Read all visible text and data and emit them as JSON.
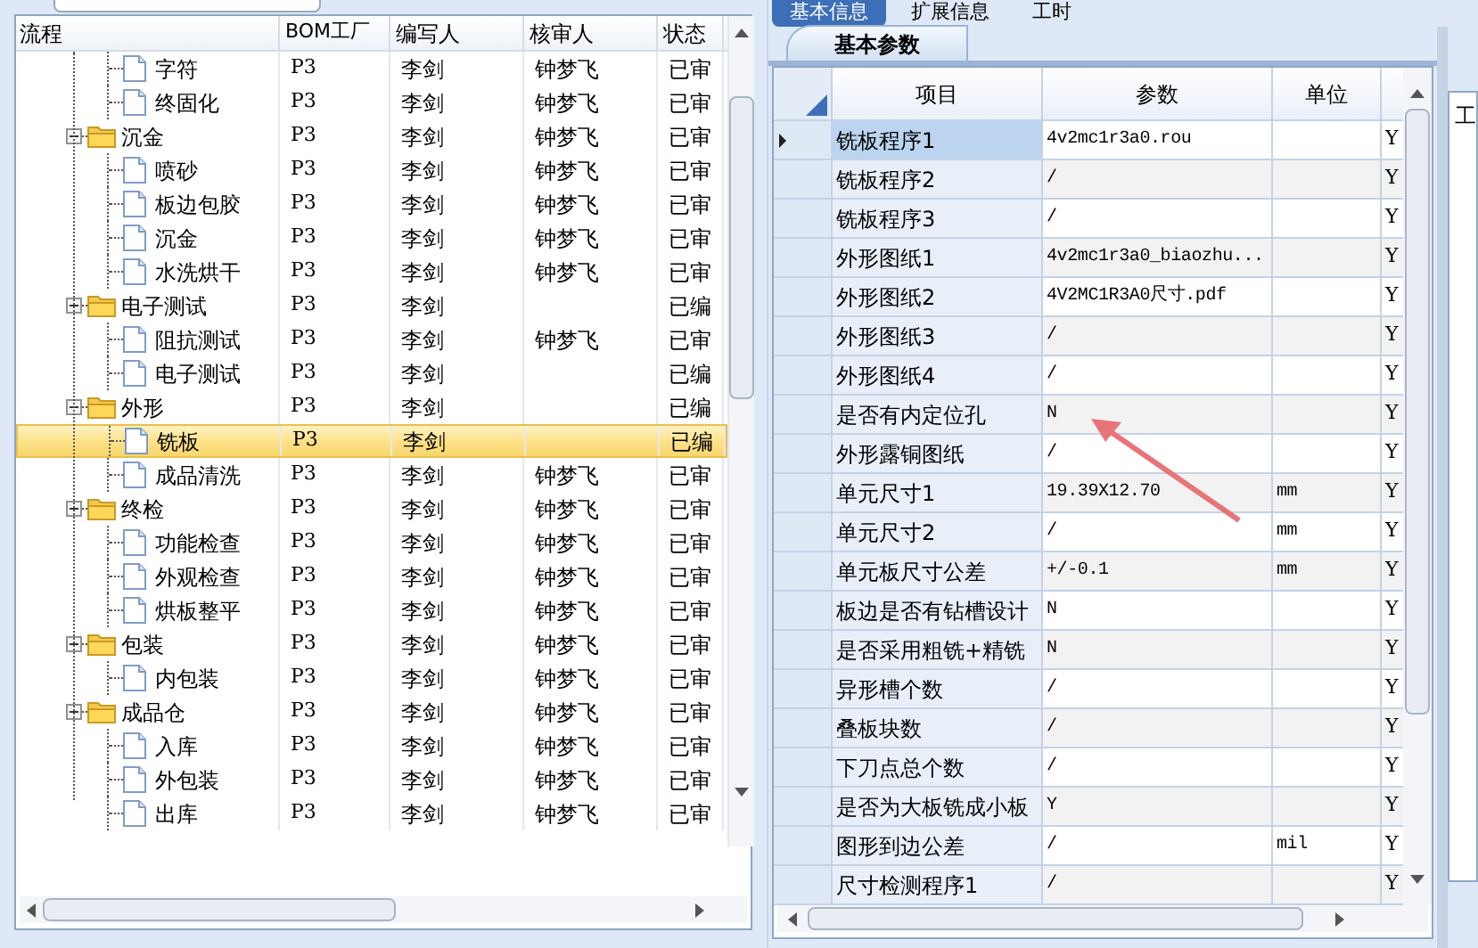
{
  "tree": {
    "columns": [
      "流程",
      "BOM工厂",
      "编写人",
      "核审人",
      "状态"
    ],
    "items": [
      {
        "kind": "file",
        "label": "字符",
        "bom": "P3",
        "author": "李剑",
        "reviewer": "钟梦飞",
        "status": "已审",
        "selected": false
      },
      {
        "kind": "file",
        "label": "终固化",
        "bom": "P3",
        "author": "李剑",
        "reviewer": "钟梦飞",
        "status": "已审",
        "selected": false
      },
      {
        "kind": "folder",
        "label": "沉金",
        "bom": "P3",
        "author": "李剑",
        "reviewer": "钟梦飞",
        "status": "已审",
        "selected": false,
        "expanded": true,
        "children": [
          {
            "kind": "file",
            "label": "喷砂",
            "bom": "P3",
            "author": "李剑",
            "reviewer": "钟梦飞",
            "status": "已审",
            "selected": false
          },
          {
            "kind": "file",
            "label": "板边包胶",
            "bom": "P3",
            "author": "李剑",
            "reviewer": "钟梦飞",
            "status": "已审",
            "selected": false
          },
          {
            "kind": "file",
            "label": "沉金",
            "bom": "P3",
            "author": "李剑",
            "reviewer": "钟梦飞",
            "status": "已审",
            "selected": false
          },
          {
            "kind": "file",
            "label": "水洗烘干",
            "bom": "P3",
            "author": "李剑",
            "reviewer": "钟梦飞",
            "status": "已审",
            "selected": false
          }
        ]
      },
      {
        "kind": "folder",
        "label": "电子测试",
        "bom": "P3",
        "author": "李剑",
        "status": "已编",
        "selected": false,
        "expanded": true,
        "children": [
          {
            "kind": "file",
            "label": "阻抗测试",
            "bom": "P3",
            "author": "李剑",
            "reviewer": "钟梦飞",
            "status": "已审",
            "selected": false
          },
          {
            "kind": "file",
            "label": "电子测试",
            "bom": "P3",
            "author": "李剑",
            "status": "已编",
            "selected": false
          }
        ]
      },
      {
        "kind": "folder",
        "label": "外形",
        "bom": "P3",
        "author": "李剑",
        "status": "已编",
        "selected": false,
        "expanded": true,
        "children": [
          {
            "kind": "file",
            "label": "铣板",
            "bom": "P3",
            "author": "李剑",
            "status": "已编",
            "selected": true
          },
          {
            "kind": "file",
            "label": "成品清洗",
            "bom": "P3",
            "author": "李剑",
            "reviewer": "钟梦飞",
            "status": "已审",
            "selected": false
          }
        ]
      },
      {
        "kind": "folder",
        "label": "终检",
        "bom": "P3",
        "author": "李剑",
        "reviewer": "钟梦飞",
        "status": "已审",
        "selected": false,
        "expanded": true,
        "children": [
          {
            "kind": "file",
            "label": "功能检查",
            "bom": "P3",
            "author": "李剑",
            "reviewer": "钟梦飞",
            "status": "已审",
            "selected": false
          },
          {
            "kind": "file",
            "label": "外观检查",
            "bom": "P3",
            "author": "李剑",
            "reviewer": "钟梦飞",
            "status": "已审",
            "selected": false
          },
          {
            "kind": "file",
            "label": "烘板整平",
            "bom": "P3",
            "author": "李剑",
            "reviewer": "钟梦飞",
            "status": "已审",
            "selected": false
          }
        ]
      },
      {
        "kind": "folder",
        "label": "包装",
        "bom": "P3",
        "author": "李剑",
        "reviewer": "钟梦飞",
        "status": "已审",
        "selected": false,
        "expanded": true,
        "children": [
          {
            "kind": "file",
            "label": "内包装",
            "bom": "P3",
            "author": "李剑",
            "reviewer": "钟梦飞",
            "status": "已审",
            "selected": false
          }
        ]
      },
      {
        "kind": "folder",
        "label": "成品仓",
        "bom": "P3",
        "author": "李剑",
        "reviewer": "钟梦飞",
        "status": "已审",
        "selected": false,
        "expanded": true,
        "children": [
          {
            "kind": "file",
            "label": "入库",
            "bom": "P3",
            "author": "李剑",
            "reviewer": "钟梦飞",
            "status": "已审",
            "selected": false
          },
          {
            "kind": "file",
            "label": "外包装",
            "bom": "P3",
            "author": "李剑",
            "reviewer": "钟梦飞",
            "status": "已审",
            "selected": false
          },
          {
            "kind": "file",
            "label": "出库",
            "bom": "P3",
            "author": "李剑",
            "reviewer": "钟梦飞",
            "status": "已审",
            "selected": false
          }
        ]
      }
    ]
  },
  "tabs": [
    {
      "label": "基本信息",
      "selected": true
    },
    {
      "label": "扩展信息",
      "selected": false
    },
    {
      "label": "工时",
      "selected": false
    }
  ],
  "sub_tabs": [
    {
      "label": "基本参数",
      "selected": true
    }
  ],
  "side_tab": {
    "label": "工"
  },
  "grid": {
    "columns": [
      "项目",
      "参数",
      "单位"
    ],
    "rows": [
      {
        "item": "铣板程序1",
        "param": "4v2mc1r3a0.rou",
        "flag": "Y",
        "selected": true
      },
      {
        "item": "铣板程序2",
        "param": "/",
        "flag": "Y",
        "selected": false
      },
      {
        "item": "铣板程序3",
        "param": "/",
        "flag": "Y",
        "selected": false
      },
      {
        "item": "外形图纸1",
        "param": "4v2mc1r3a0_biaozhu...",
        "flag": "Y",
        "selected": false
      },
      {
        "item": "外形图纸2",
        "param": "4V2MC1R3A0尺寸.pdf",
        "flag": "Y",
        "selected": false
      },
      {
        "item": "外形图纸3",
        "param": "/",
        "flag": "Y",
        "selected": false
      },
      {
        "item": "外形图纸4",
        "param": "/",
        "flag": "Y",
        "selected": false
      },
      {
        "item": "是否有内定位孔",
        "param": "N",
        "flag": "Y",
        "selected": false
      },
      {
        "item": "外形露铜图纸",
        "param": "/",
        "flag": "Y",
        "selected": false
      },
      {
        "item": "单元尺寸1",
        "param": "19.39X12.70",
        "unit": "mm",
        "flag": "Y",
        "selected": false
      },
      {
        "item": "单元尺寸2",
        "param": "/",
        "unit": "mm",
        "flag": "Y",
        "selected": false
      },
      {
        "item": "单元板尺寸公差",
        "param": "+/-0.1",
        "unit": "mm",
        "flag": "Y",
        "selected": false
      },
      {
        "item": "板边是否有钻槽设计",
        "param": "N",
        "flag": "Y",
        "selected": false
      },
      {
        "item": "是否采用粗铣+精铣",
        "param": "N",
        "flag": "Y",
        "selected": false
      },
      {
        "item": "异形槽个数",
        "param": "/",
        "flag": "Y",
        "selected": false
      },
      {
        "item": "叠板块数",
        "param": "/",
        "flag": "Y",
        "selected": false
      },
      {
        "item": "下刀点总个数",
        "param": "/",
        "flag": "Y",
        "selected": false
      },
      {
        "item": "是否为大板铣成小板",
        "param": "Y",
        "flag": "Y",
        "selected": false
      },
      {
        "item": "图形到边公差",
        "param": "/",
        "unit": "mil",
        "flag": "Y",
        "selected": false
      },
      {
        "item": "尺寸检测程序1",
        "param": "/",
        "flag": "Y",
        "selected": false
      }
    ]
  }
}
